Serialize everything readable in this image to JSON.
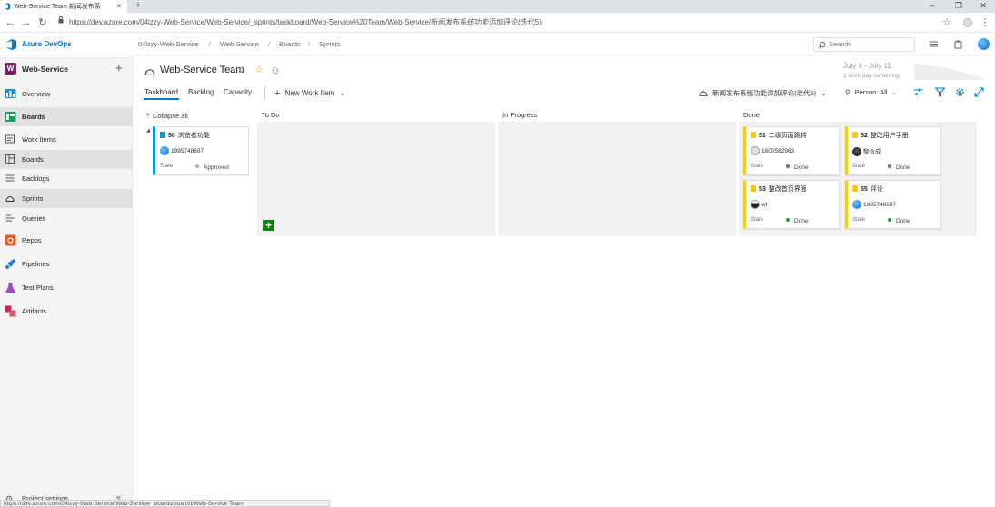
{
  "browser": {
    "tab_title": "Web-Service Team 新闻发布系",
    "new_tab": "+",
    "url": "https://dev.azure.com/04lzzy-Web-Service/Web-Service/_sprints/taskboard/Web-Service%20Team/Web-Service/新闻发布系统功能添加评论(迭代5)",
    "status_url": "https://dev.azure.com/04lzzy-Web-Service/Web-Service/_boards/board/t/Web-Service Team"
  },
  "header": {
    "product": "Azure DevOps",
    "breadcrumbs": [
      "04lzzy-Web-Service",
      "Web-Service",
      "Boards",
      "Sprints"
    ],
    "search_placeholder": "Search"
  },
  "sidebar": {
    "project_initial": "W",
    "project_name": "Web-Service",
    "items": [
      {
        "label": "Overview",
        "icon": "overview-icon"
      },
      {
        "label": "Boards",
        "icon": "boards-icon"
      },
      {
        "label": "Work Items",
        "icon": "work-items-icon"
      },
      {
        "label": "Boards",
        "icon": "board-icon"
      },
      {
        "label": "Backlogs",
        "icon": "backlogs-icon"
      },
      {
        "label": "Sprints",
        "icon": "sprints-icon"
      },
      {
        "label": "Queries",
        "icon": "queries-icon"
      },
      {
        "label": "Repos",
        "icon": "repos-icon"
      },
      {
        "label": "Pipelines",
        "icon": "pipelines-icon"
      },
      {
        "label": "Test Plans",
        "icon": "test-plans-icon"
      },
      {
        "label": "Artifacts",
        "icon": "artifacts-icon"
      }
    ],
    "project_settings": "Project settings"
  },
  "team": {
    "name": "Web-Service Team",
    "dates": "July 4 - July 11",
    "remaining": "1 work day remaining"
  },
  "pivots": {
    "taskboard": "Taskboard",
    "backlog": "Backlog",
    "capacity": "Capacity",
    "new_work_item": "New Work Item"
  },
  "toolbar": {
    "iteration": "新闻发布系统功能添加评论(迭代5)",
    "person": "Person: All"
  },
  "board": {
    "collapse_all": "Collapse all",
    "columns": [
      "To Do",
      "In Progress",
      "Done"
    ],
    "parent": {
      "id": "50",
      "title": "浏览者功能",
      "assignee": "1985748697",
      "state_label": "State",
      "state": "Approved"
    },
    "done_cards": [
      {
        "id": "51",
        "title": "二级页面跳转",
        "assignee": "1600582963",
        "state_label": "State",
        "state": "Done"
      },
      {
        "id": "52",
        "title": "整改用户手册",
        "assignee": "黎合成",
        "state_label": "State",
        "state": "Done"
      },
      {
        "id": "53",
        "title": "整改首页界面",
        "assignee": "wt",
        "state_label": "State",
        "state": "Done"
      },
      {
        "id": "55",
        "title": "评论",
        "assignee": "1985748697",
        "state_label": "State",
        "state": "Done"
      }
    ]
  },
  "colors": {
    "accent": "#0078d4",
    "task": "#f2cb1d",
    "pbi": "#009ccc",
    "done": "#339933",
    "approved": "#b2b2b2",
    "add": "#107c10"
  }
}
